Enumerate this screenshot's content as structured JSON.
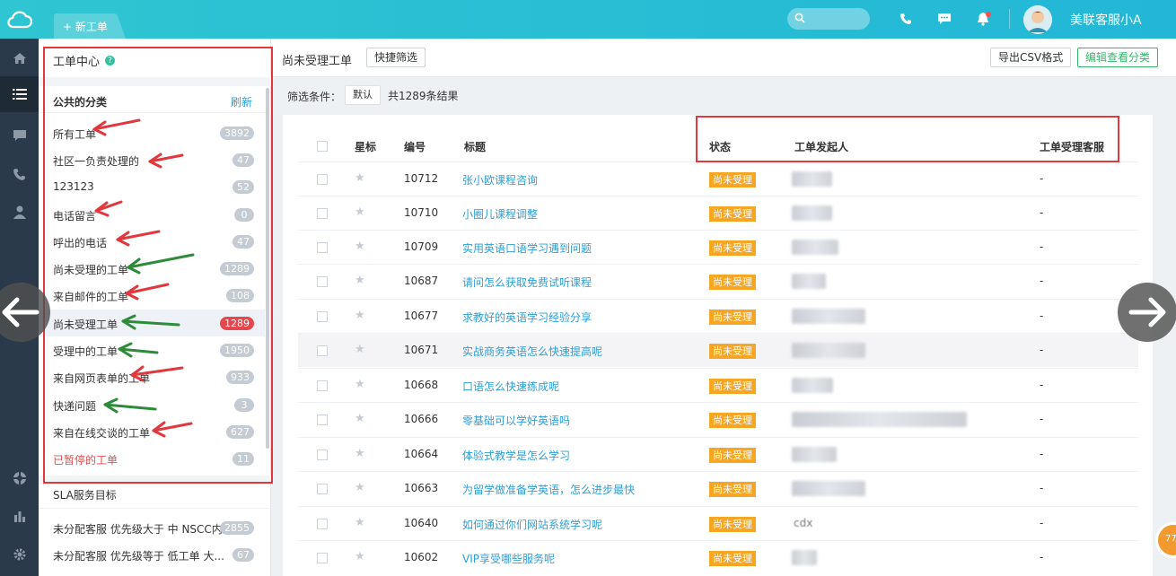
{
  "header": {
    "new_tab": "+ 新工单",
    "username": "美联客服小A",
    "search_placeholder": ""
  },
  "sidebar": {
    "title": "工单中心",
    "help": "?",
    "section_public": "公共的分类",
    "refresh": "刷新",
    "items": [
      {
        "label": "所有工单",
        "count": "3892"
      },
      {
        "label": "社区一负责处理的",
        "count": "47"
      },
      {
        "label": "123123",
        "count": "52"
      },
      {
        "label": "电话留言",
        "count": "0"
      },
      {
        "label": "呼出的电话",
        "count": "47"
      },
      {
        "label": "尚未受理的工单",
        "count": "1289"
      },
      {
        "label": "来自邮件的工单",
        "count": "108"
      },
      {
        "label": "尚未受理工单",
        "count": "1289"
      },
      {
        "label": "受理中的工单",
        "count": "1950"
      },
      {
        "label": "来自网页表单的工单",
        "count": "933"
      },
      {
        "label": "快递问题",
        "count": "3"
      },
      {
        "label": "来自在线交谈的工单",
        "count": "627"
      },
      {
        "label": "已暂停的工单",
        "count": "11"
      }
    ],
    "section_sla": "SLA服务目标",
    "sla_items": [
      {
        "label": "未分配客服 优先级大于 中 NSCC内...",
        "count": "2855"
      },
      {
        "label": "未分配客服 优先级等于 低工单 大...",
        "count": "67"
      }
    ]
  },
  "main": {
    "title": "尚未受理工单",
    "quick_filter": "快捷筛选",
    "export_csv": "导出CSV格式",
    "edit_view": "编辑查看分类",
    "filter_label": "筛选条件：",
    "filter_default": "默认",
    "result_count": "共1289条结果",
    "columns": {
      "star": "星标",
      "number": "编号",
      "title": "标题",
      "status": "状态",
      "requester": "工单发起人",
      "assignee": "工单受理客服"
    },
    "rows": [
      {
        "number": "10712",
        "title": "张小欧课程咨询",
        "status": "尚未受理",
        "assignee": "-"
      },
      {
        "number": "10710",
        "title": "小圈儿课程调整",
        "status": "尚未受理",
        "assignee": "-"
      },
      {
        "number": "10709",
        "title": "实用英语口语学习遇到问题",
        "status": "尚未受理",
        "assignee": "-"
      },
      {
        "number": "10687",
        "title": "请问怎么获取免费试听课程",
        "status": "尚未受理",
        "assignee": "-"
      },
      {
        "number": "10677",
        "title": "求教好的英语学习经验分享",
        "status": "尚未受理",
        "assignee": "-"
      },
      {
        "number": "10671",
        "title": "实战商务英语怎么快速提高呢",
        "status": "尚未受理",
        "assignee": "-"
      },
      {
        "number": "10668",
        "title": "口语怎么快速练成呢",
        "status": "尚未受理",
        "assignee": "-"
      },
      {
        "number": "10666",
        "title": "零基础可以学好英语吗",
        "status": "尚未受理",
        "assignee": "-"
      },
      {
        "number": "10664",
        "title": "体验式教学是怎么学习",
        "status": "尚未受理",
        "assignee": "-"
      },
      {
        "number": "10663",
        "title": "为留学做准备学英语，怎么进步最快",
        "status": "尚未受理",
        "assignee": "-"
      },
      {
        "number": "10640",
        "title": "如何通过你们网站系统学习呢",
        "status": "尚未受理",
        "assignee": "-",
        "requester_partial": "cdx"
      },
      {
        "number": "10602",
        "title": "VIP享受哪些服务呢",
        "status": "尚未受理",
        "assignee": "-"
      }
    ]
  },
  "floating_badge": "77",
  "colors": {
    "topbar": "#22b7d6",
    "status": "#f6a623",
    "link": "#2d9fd8",
    "annotation_red": "#e0383e"
  }
}
